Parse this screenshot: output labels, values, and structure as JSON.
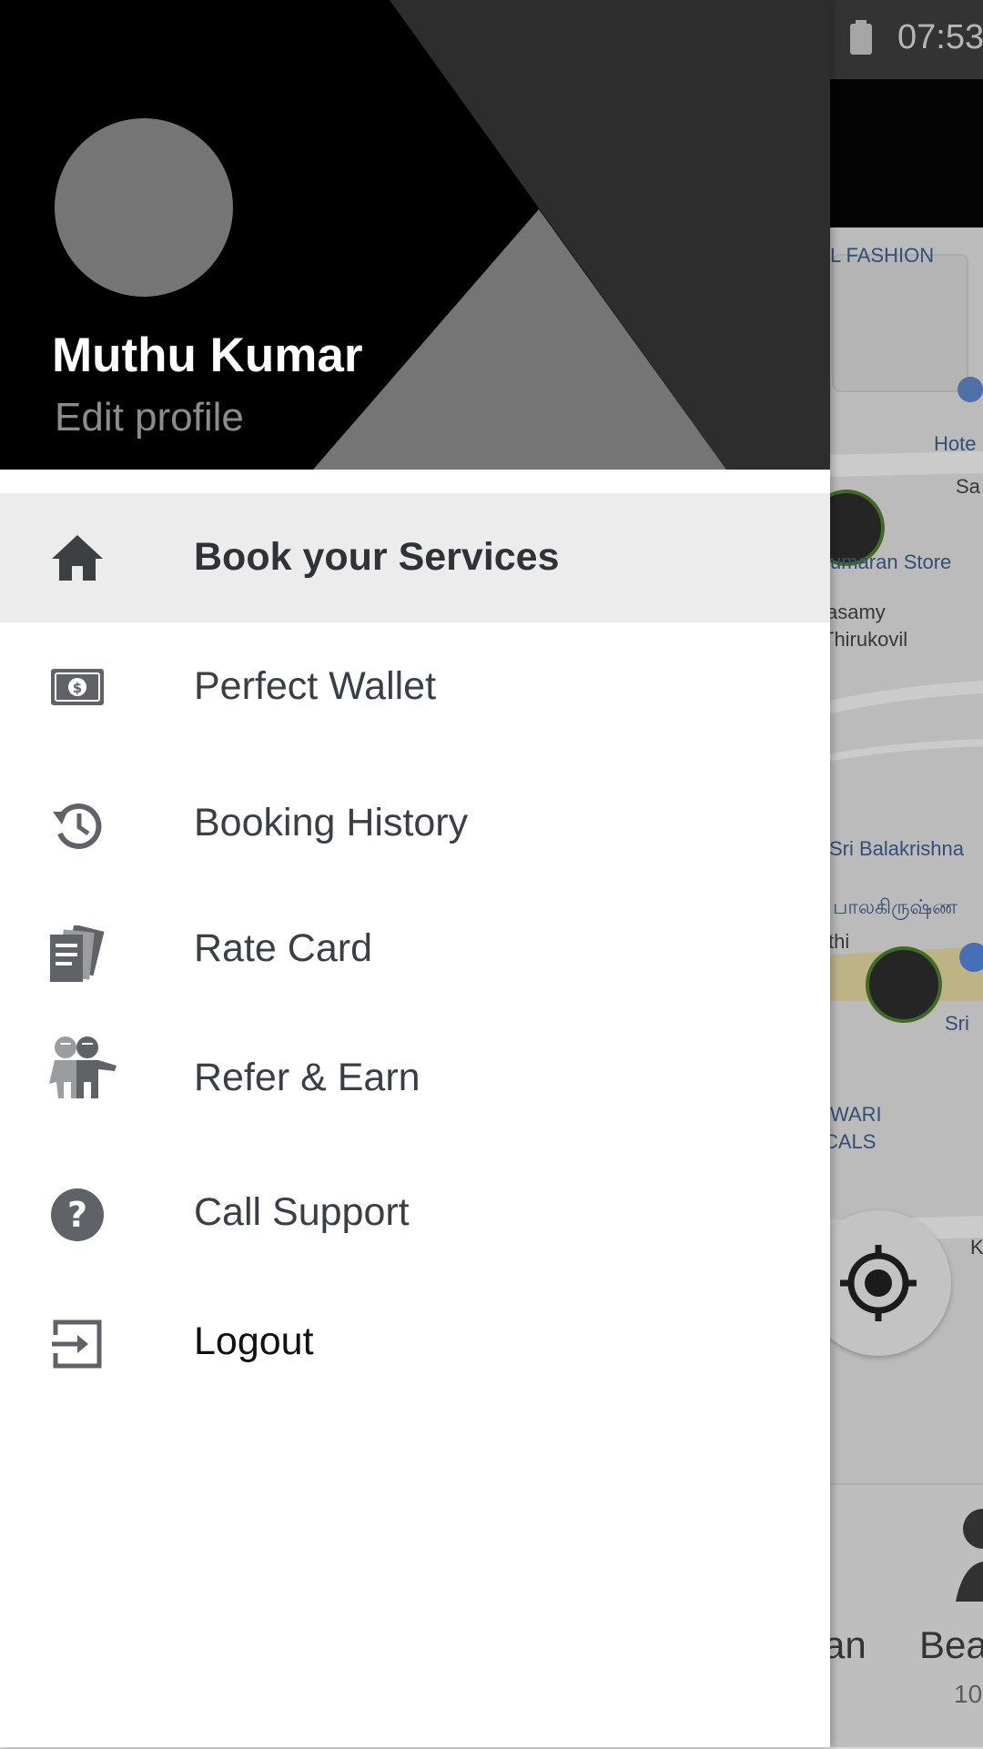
{
  "status_bar": {
    "time": "07:53"
  },
  "profile": {
    "name": "Muthu Kumar",
    "edit_label": "Edit profile"
  },
  "menu": {
    "items": [
      {
        "label": "Book your Services",
        "icon": "home-icon",
        "selected": true
      },
      {
        "label": "Perfect Wallet",
        "icon": "money-icon",
        "selected": false
      },
      {
        "label": "Booking History",
        "icon": "history-icon",
        "selected": false
      },
      {
        "label": "Rate Card",
        "icon": "rate-card-icon",
        "selected": false
      },
      {
        "label": "Refer & Earn",
        "icon": "refer-people-icon",
        "selected": false
      },
      {
        "label": "Call Support",
        "icon": "help-icon",
        "selected": false
      },
      {
        "label": "Logout",
        "icon": "logout-icon",
        "selected": false
      }
    ]
  },
  "map": {
    "labels": [
      "L FASHION",
      "Hote",
      "Sa",
      "umaran Store",
      "asamy",
      "Thirukovil",
      "Sri Balakrishna",
      "பாலகிருஷ்ண",
      "thi",
      "Sri",
      "WARI",
      "CALS",
      "K"
    ]
  },
  "bottom_bar": {
    "partial_label_1": "an",
    "partial_label_2": "Bea",
    "partial_sub_2": "10"
  },
  "colors": {
    "header_black": "#000000",
    "header_dark": "#2d2d2d",
    "header_grey": "#757575",
    "selected_bg": "#ececec",
    "icon_grey": "#5f6368"
  }
}
